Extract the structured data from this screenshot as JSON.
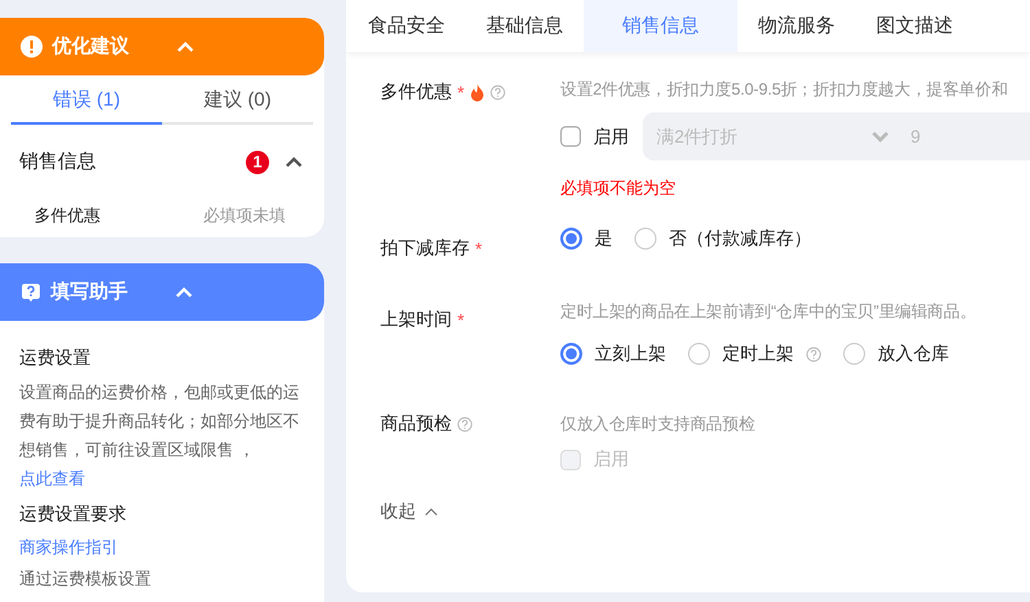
{
  "error_panel": {
    "title": "优化建议",
    "expanded": true,
    "tabs": [
      {
        "label": "错误 (1)",
        "selected": true
      },
      {
        "label": "建议 (0)",
        "selected": false
      }
    ],
    "sections": [
      {
        "title": "销售信息",
        "badge": "1",
        "expanded": true,
        "items": [
          {
            "label": "多件优惠",
            "status": "必填项未填"
          }
        ]
      }
    ]
  },
  "helper_panel": {
    "title": "填写助手",
    "expanded": true,
    "blocks": [
      {
        "kind": "heading",
        "text": "运费设置"
      },
      {
        "kind": "paragraph",
        "text": "设置商品的运费价格，包邮或更低的运费有助于提升商品转化；如部分地区不想销售，可前往设置区域限售 ，",
        "link": "点此查看"
      },
      {
        "kind": "heading",
        "text": "运费设置要求"
      },
      {
        "kind": "link",
        "text": "商家操作指引"
      },
      {
        "kind": "paragraph",
        "text": "通过运费模板设置"
      }
    ]
  },
  "tabs": [
    {
      "label": "食品安全",
      "selected": false
    },
    {
      "label": "基础信息",
      "selected": false
    },
    {
      "label": "销售信息",
      "selected": true
    },
    {
      "label": "物流服务",
      "selected": false
    },
    {
      "label": "图文描述",
      "selected": false
    }
  ],
  "fields": [
    {
      "kind": "discount",
      "label": "多件优惠",
      "required": "*",
      "hot": true,
      "help": true,
      "hint": "设置2件优惠，折扣力度5.0-9.5折；折扣力度越大，提客单价和",
      "checkbox": {
        "label": "启用",
        "checked": false,
        "disabled": false
      },
      "select": {
        "value": "满2件打折"
      },
      "amount": "9",
      "error": "必填项不能为空"
    },
    {
      "kind": "radio",
      "label": "拍下减库存",
      "required": "*",
      "options": [
        {
          "label": "是",
          "selected": true
        },
        {
          "label": "否（付款减库存）",
          "selected": false
        }
      ]
    },
    {
      "kind": "radio",
      "label": "上架时间",
      "required": "*",
      "hint": "定时上架的商品在上架前请到“仓库中的宝贝”里编辑商品。",
      "options": [
        {
          "label": "立刻上架",
          "selected": true
        },
        {
          "label": "定时上架",
          "selected": false,
          "help": true
        },
        {
          "label": "放入仓库",
          "selected": false
        }
      ]
    },
    {
      "kind": "checkbox",
      "label": "商品预检",
      "help": true,
      "hint": "仅放入仓库时支持商品预检",
      "checkbox": {
        "label": "启用",
        "checked": false,
        "disabled": true
      }
    }
  ],
  "collapse": {
    "label": "收起"
  }
}
